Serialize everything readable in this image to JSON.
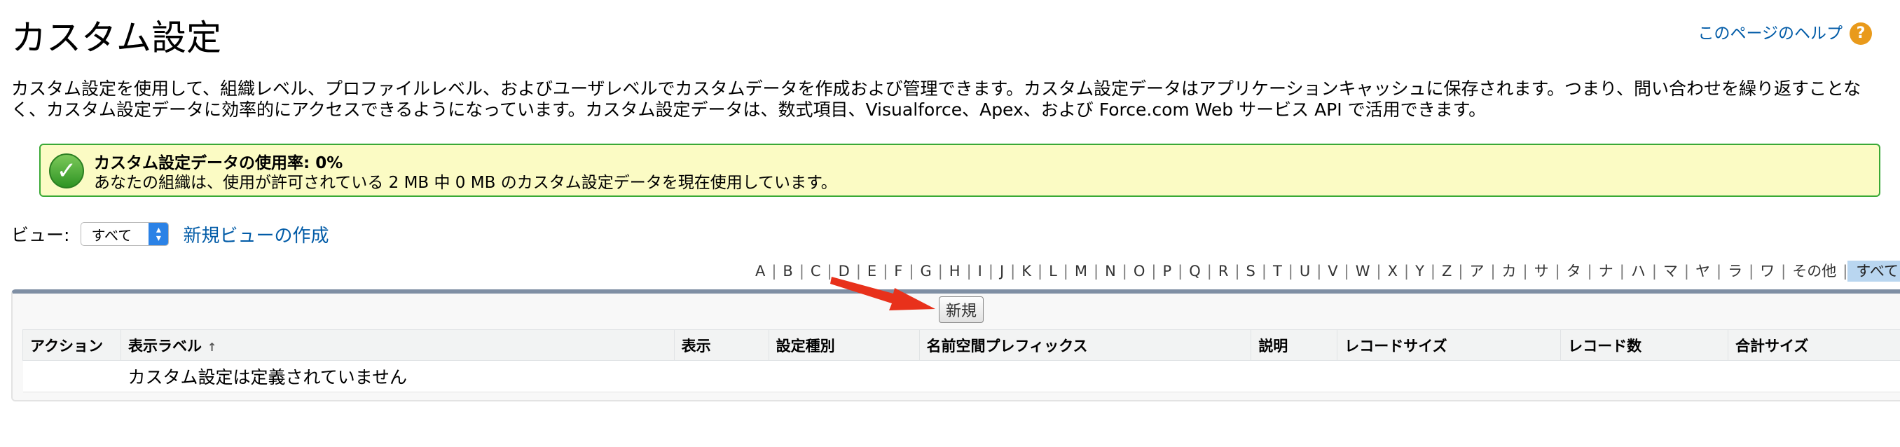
{
  "header": {
    "title": "カスタム設定",
    "help_label": "このページのヘルプ",
    "help_icon": "question-icon"
  },
  "description": "カスタム設定を使用して、組織レベル、プロファイルレベル、およびユーザレベルでカスタムデータを作成および管理できます。カスタム設定データはアプリケーションキャッシュに保存されます。つまり、問い合わせを繰り返すことなく、カスタム設定データに効率的にアクセスできるようになっています。カスタム設定データは、数式項目、Visualforce、Apex、および Force.com Web サービス API で活用できます。",
  "usage": {
    "title": "カスタム設定データの使用率: 0%",
    "text": "あなたの組織は、使用が許可されている 2 MB 中 0 MB のカスタム設定データを現在使用しています。",
    "icon": "checkmark-icon",
    "border_color": "#39a936",
    "bg_color": "#fbfbc4"
  },
  "view": {
    "label": "ビュー:",
    "selected": "すべて",
    "create_link": "新規ビューの作成"
  },
  "alpha_filter": [
    "A",
    "B",
    "C",
    "D",
    "E",
    "F",
    "G",
    "H",
    "I",
    "J",
    "K",
    "L",
    "M",
    "N",
    "O",
    "P",
    "Q",
    "R",
    "S",
    "T",
    "U",
    "V",
    "W",
    "X",
    "Y",
    "Z",
    "ア",
    "カ",
    "サ",
    "タ",
    "ナ",
    "ハ",
    "マ",
    "ヤ",
    "ラ",
    "ワ",
    "その他",
    "すべて"
  ],
  "alpha_selected": "すべて",
  "toolbar": {
    "new_label": "新規"
  },
  "table": {
    "columns": [
      "アクション",
      "表示ラベル",
      "表示",
      "設定種別",
      "名前空間プレフィックス",
      "説明",
      "レコードサイズ",
      "レコード数",
      "合計サイズ"
    ],
    "sort_indicator": "↑",
    "empty_message": "カスタム設定は定義されていません"
  },
  "colors": {
    "link": "#015ba7",
    "annotation_arrow": "#e8311b",
    "panel_top": "#7f8fa4"
  }
}
